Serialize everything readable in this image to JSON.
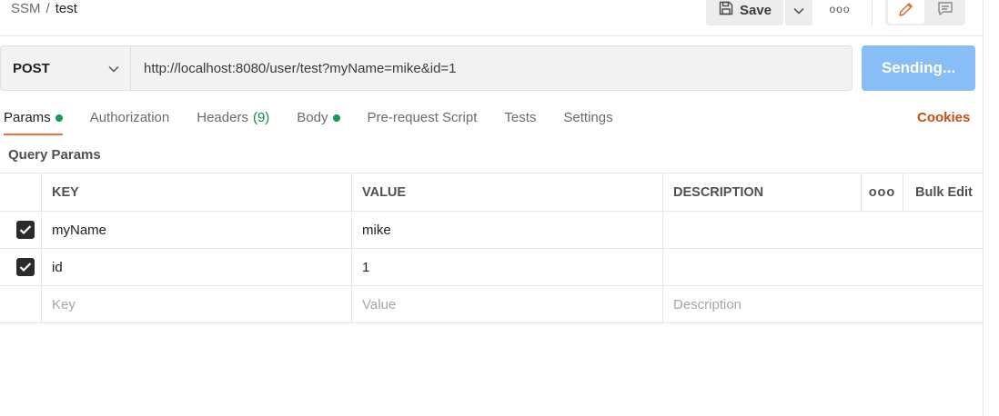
{
  "breadcrumb": {
    "collection": "SSM",
    "separator": "/",
    "request": "test"
  },
  "toolbar": {
    "save_label": "Save",
    "more_label": "ooo"
  },
  "request": {
    "method": "POST",
    "url": "http://localhost:8080/user/test?myName=mike&id=1",
    "send_label": "Sending..."
  },
  "tabs": [
    {
      "label": "Params",
      "has_dot": true,
      "active": true
    },
    {
      "label": "Authorization"
    },
    {
      "label": "Headers",
      "count": "(9)"
    },
    {
      "label": "Body",
      "has_dot": true
    },
    {
      "label": "Pre-request Script"
    },
    {
      "label": "Tests"
    },
    {
      "label": "Settings"
    }
  ],
  "cookies_label": "Cookies",
  "query_params": {
    "title": "Query Params",
    "columns": {
      "key": "KEY",
      "value": "VALUE",
      "description": "DESCRIPTION",
      "more": "ooo",
      "bulk_edit": "Bulk Edit"
    },
    "rows": [
      {
        "checked": true,
        "key": "myName",
        "value": "mike",
        "description": ""
      },
      {
        "checked": true,
        "key": "id",
        "value": "1",
        "description": ""
      }
    ],
    "placeholders": {
      "key": "Key",
      "value": "Value",
      "description": "Description"
    }
  },
  "colors": {
    "accent": "#ff6c37",
    "link": "#d14a12",
    "send_button": "#88bdf5",
    "status_dot": "#0f9d58"
  },
  "icons": [
    "save-icon",
    "chevron-down-icon",
    "more-icon",
    "pencil-icon",
    "comment-icon",
    "check-icon"
  ]
}
